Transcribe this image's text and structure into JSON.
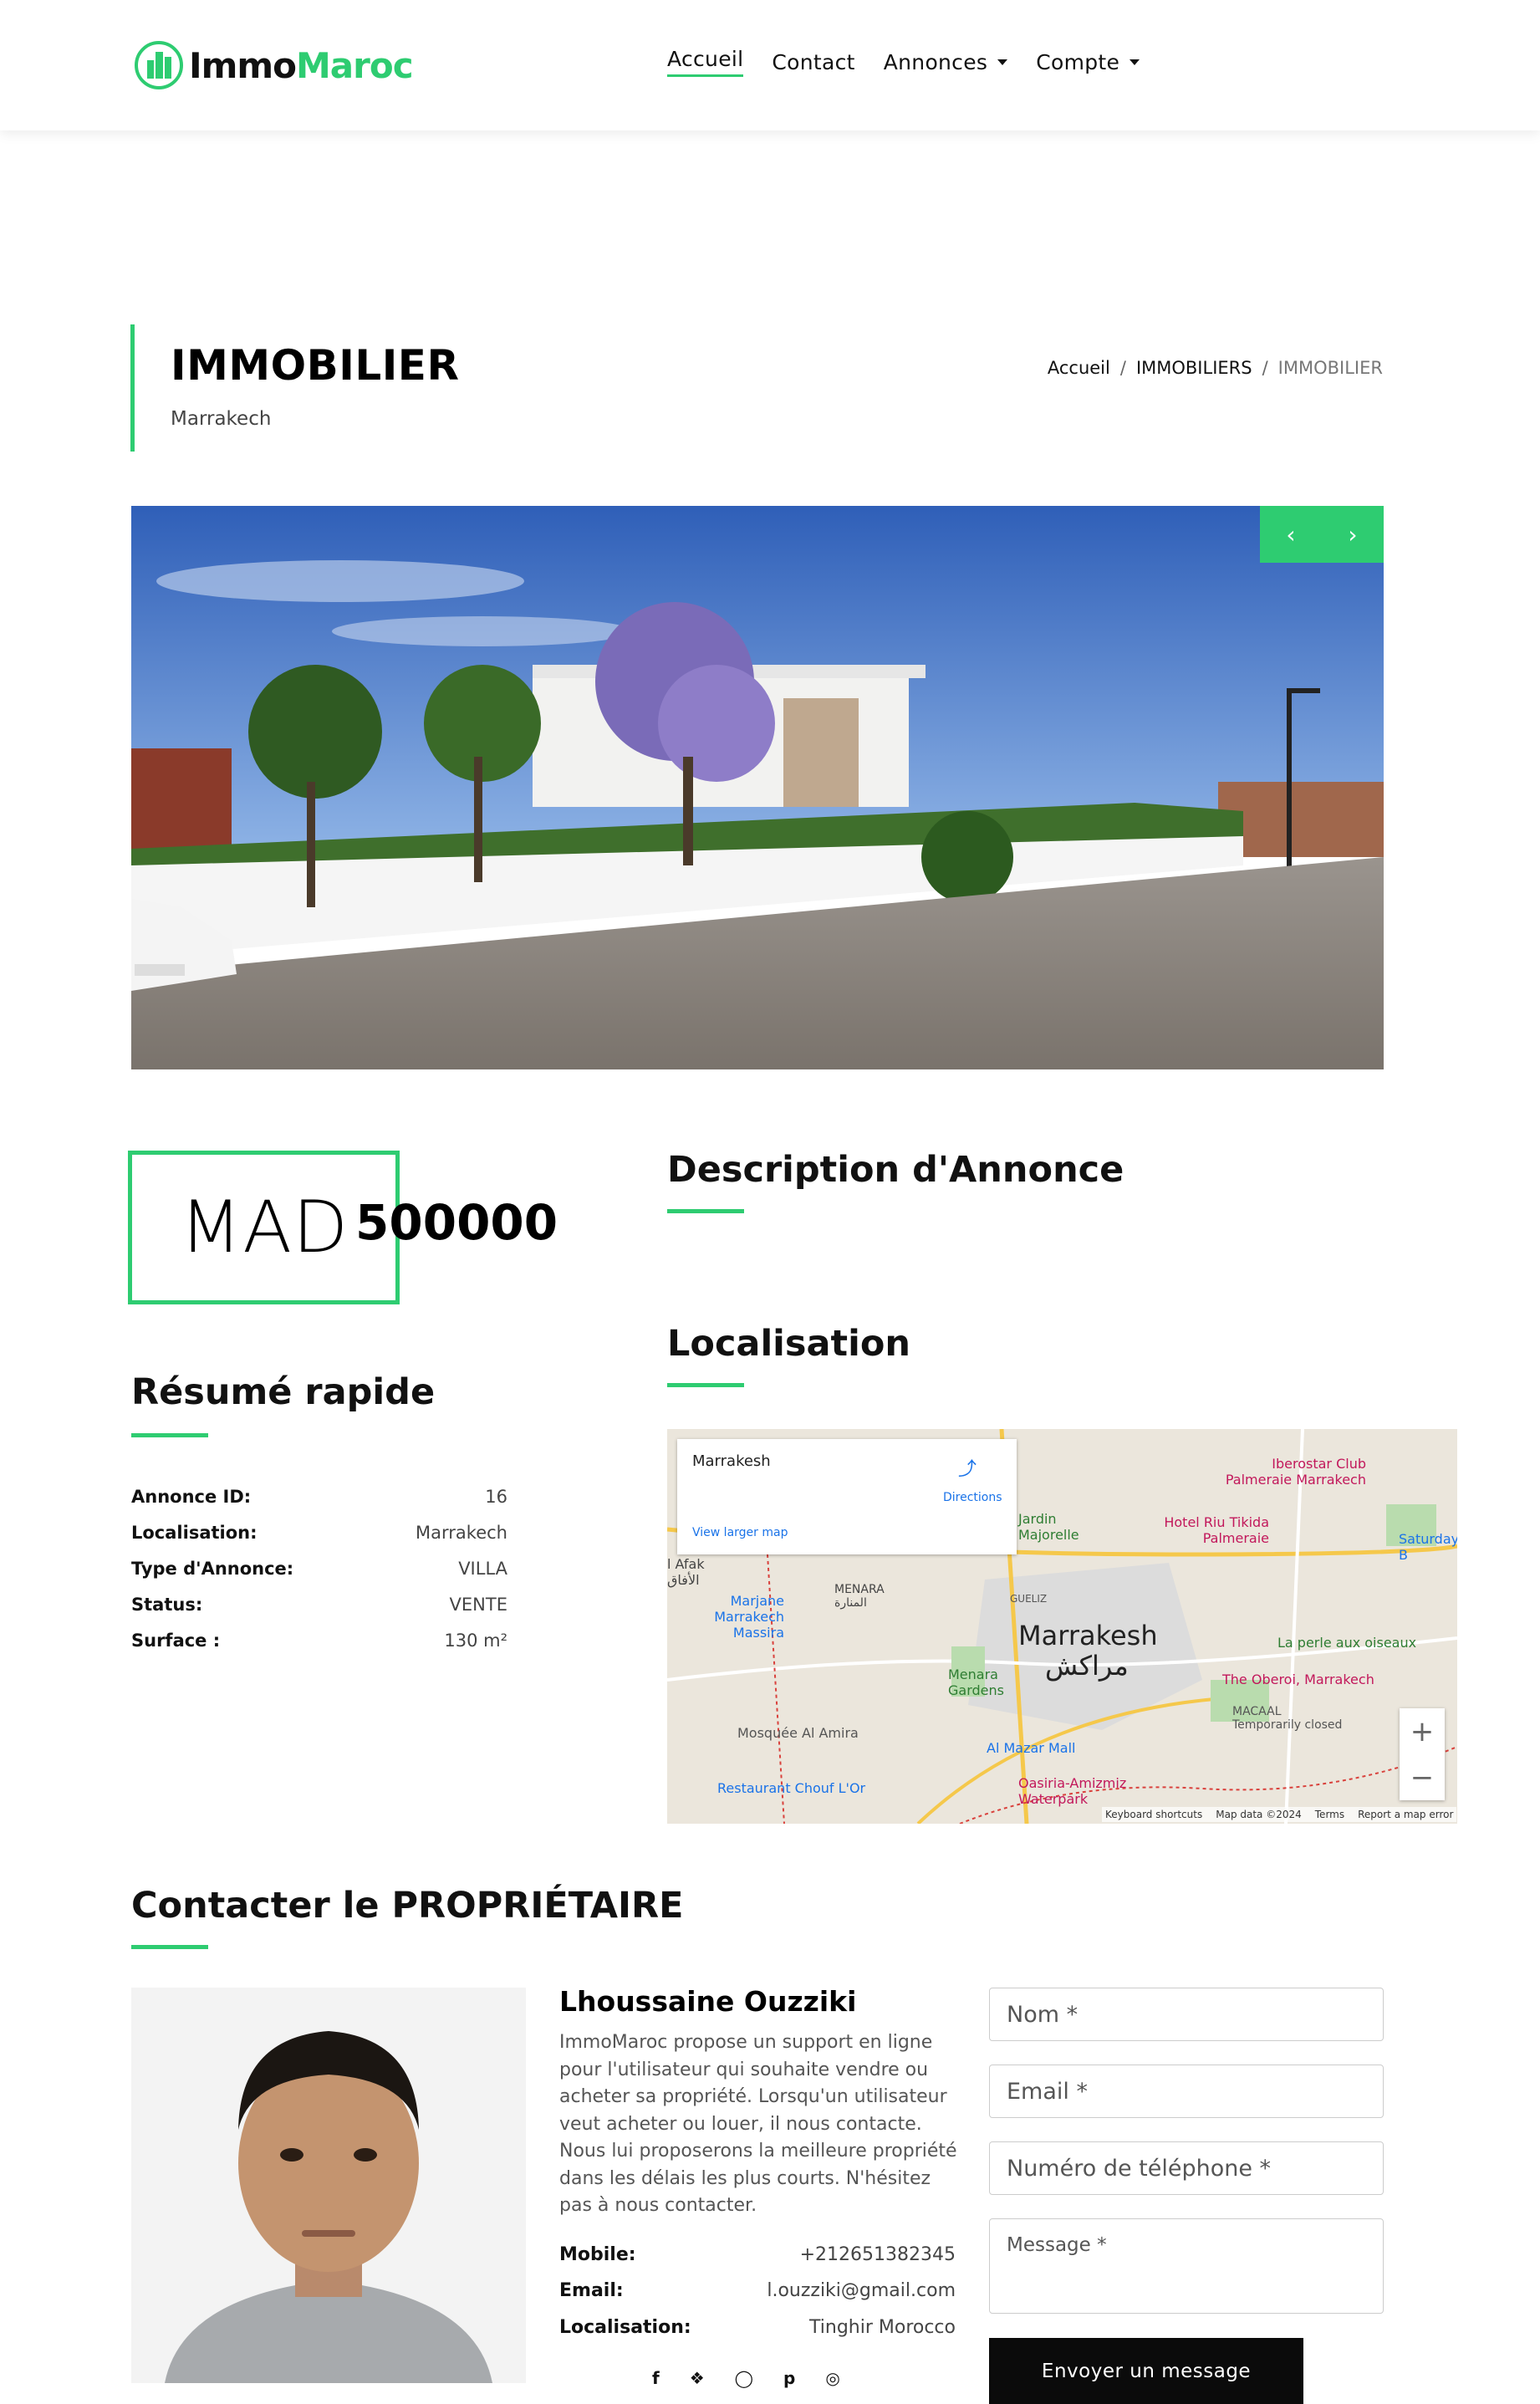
{
  "brand": {
    "part1": "Immo",
    "part2": "Maroc"
  },
  "nav": {
    "items": [
      {
        "label": "Accueil",
        "active": true,
        "dropdown": false
      },
      {
        "label": "Contact",
        "active": false,
        "dropdown": false
      },
      {
        "label": "Annonces",
        "active": false,
        "dropdown": true
      },
      {
        "label": "Compte",
        "active": false,
        "dropdown": true
      }
    ]
  },
  "page": {
    "title": "IMMOBILIER",
    "subtitle": "Marrakech",
    "breadcrumb": [
      "Accueil",
      "IMMOBILIERS",
      "IMMOBILIER"
    ]
  },
  "price": {
    "currency": "MAD",
    "value": "500000"
  },
  "sections": {
    "summary": "Résumé rapide",
    "description": "Description d'Annonce",
    "location": "Localisation",
    "contact": "Contacter le PROPRIÉTAIRE"
  },
  "summary": [
    {
      "key": "Annonce ID:",
      "value": "16"
    },
    {
      "key": "Localisation:",
      "value": "Marrakech"
    },
    {
      "key": "Type d'Annonce:",
      "value": "VILLA"
    },
    {
      "key": "Status:",
      "value": "VENTE"
    },
    {
      "key": "Surface :",
      "value": "130 m²"
    }
  ],
  "map": {
    "place": "Marrakesh",
    "directions": "Directions",
    "larger": "View larger map",
    "city_label": "Marrakesh",
    "city_arabic": "مراكش",
    "labels": [
      "Iberostar Club Palmeraie Marrakech",
      "Hotel Riu Tikida Palmeraie",
      "Jardin Majorelle",
      "MENARA المنارة",
      "Marjane Marrakech Massira",
      "GUELIZ",
      "Menara Gardens",
      "La perle aux oiseaux",
      "The Oberoi, Marrakech",
      "MACAAL Temporarily closed",
      "Mosquée Al Amira",
      "Al Mazar Mall",
      "Oasiria-Amizmiz Waterpark",
      "Restaurant Chouf L'Or",
      "l Afak الأفاق",
      "Saturday B"
    ],
    "footer": [
      "Keyboard shortcuts",
      "Map data ©2024",
      "Terms",
      "Report a map error"
    ],
    "zoom_in": "+",
    "zoom_out": "−"
  },
  "owner": {
    "name": "Lhoussaine Ouzziki",
    "description": "ImmoMaroc propose un support en ligne pour l'utilisateur qui souhaite vendre ou acheter sa propriété. Lorsqu'un utilisateur veut acheter ou louer, il nous contacte. Nous lui proposerons la meilleure propriété dans les délais les plus courts. N'hésitez pas à nous contacter.",
    "details": [
      {
        "key": "Mobile:",
        "value": "+212651382345"
      },
      {
        "key": "Email:",
        "value": "l.ouzziki@gmail.com"
      },
      {
        "key": "Localisation:",
        "value": "Tinghir Morocco"
      }
    ],
    "social": [
      "f",
      "t",
      "ig",
      "p",
      "d"
    ]
  },
  "form": {
    "name_placeholder": "Nom *",
    "email_placeholder": "Email *",
    "phone_placeholder": "Numéro de téléphone *",
    "message_placeholder": "Message *",
    "submit": "Envoyer un message"
  },
  "colors": {
    "accent": "#2ecc71",
    "dark": "#0b0b0b"
  }
}
